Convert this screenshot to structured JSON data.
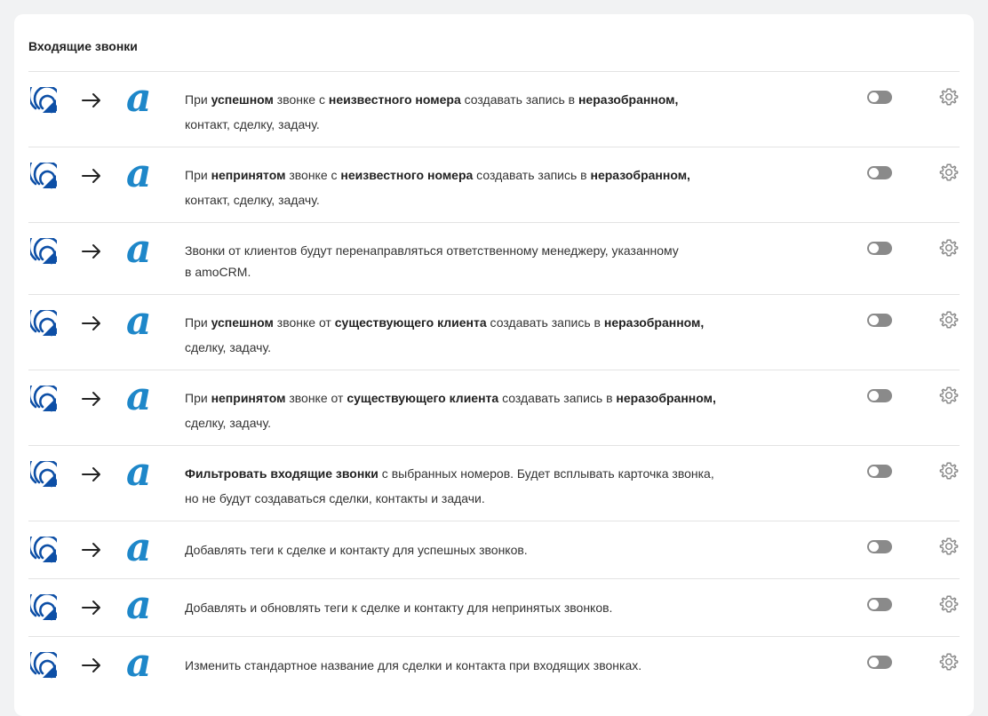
{
  "section": {
    "title": "Входящие звонки"
  },
  "colors": {
    "logo": "#1e87c9",
    "icon_blue": "#0d4fa6",
    "toggle_off": "#8a8a8a",
    "gear": "#888888"
  },
  "icons": {
    "source": "incoming-calls-icon",
    "arrow": "arrow-right-icon",
    "target": "amocrm-logo",
    "settings": "gear-icon"
  },
  "logo_text": "a",
  "rows": [
    {
      "parts": [
        {
          "t": "При "
        },
        {
          "t": "успешном",
          "b": true
        },
        {
          "t": " звонке с "
        },
        {
          "t": "неизвестного номера",
          "b": true
        },
        {
          "t": " создавать запись в "
        },
        {
          "t": "неразобранном,",
          "b": true
        },
        {
          "t": "\nконтакт, сделку, задачу."
        }
      ],
      "enabled": false
    },
    {
      "parts": [
        {
          "t": "При "
        },
        {
          "t": "непринятом",
          "b": true
        },
        {
          "t": " звонке с "
        },
        {
          "t": "неизвестного номера",
          "b": true
        },
        {
          "t": " создавать запись в "
        },
        {
          "t": "неразобранном,",
          "b": true
        },
        {
          "t": "\nконтакт, сделку, задачу."
        }
      ],
      "enabled": false
    },
    {
      "parts": [
        {
          "t": "Звонки от клиентов будут перенаправляться ответственному менеджеру, указанному\nв amoCRM."
        }
      ],
      "enabled": false
    },
    {
      "parts": [
        {
          "t": "При "
        },
        {
          "t": "успешном",
          "b": true
        },
        {
          "t": " звонке от "
        },
        {
          "t": "существующего клиента",
          "b": true
        },
        {
          "t": " создавать запись в "
        },
        {
          "t": "неразобранном,",
          "b": true
        },
        {
          "t": "\nсделку, задачу."
        }
      ],
      "enabled": false
    },
    {
      "parts": [
        {
          "t": "При "
        },
        {
          "t": "непринятом",
          "b": true
        },
        {
          "t": " звонке от "
        },
        {
          "t": "существующего клиента",
          "b": true
        },
        {
          "t": " создавать запись в "
        },
        {
          "t": "неразобранном,",
          "b": true
        },
        {
          "t": "\nсделку, задачу."
        }
      ],
      "enabled": false
    },
    {
      "parts": [
        {
          "t": "Фильтровать входящие звонки",
          "b": true
        },
        {
          "t": " с выбранных номеров. Будет всплывать карточка звонка,\nно не будут создаваться сделки, контакты и задачи."
        }
      ],
      "enabled": false
    },
    {
      "parts": [
        {
          "t": "Добавлять теги к сделке и контакту для успешных звонков."
        }
      ],
      "enabled": false
    },
    {
      "parts": [
        {
          "t": "Добавлять и обновлять теги к сделке и контакту для непринятых звонков."
        }
      ],
      "enabled": false
    },
    {
      "parts": [
        {
          "t": "Изменить стандартное название для сделки и контакта при входящих звонках."
        }
      ],
      "enabled": false
    }
  ]
}
